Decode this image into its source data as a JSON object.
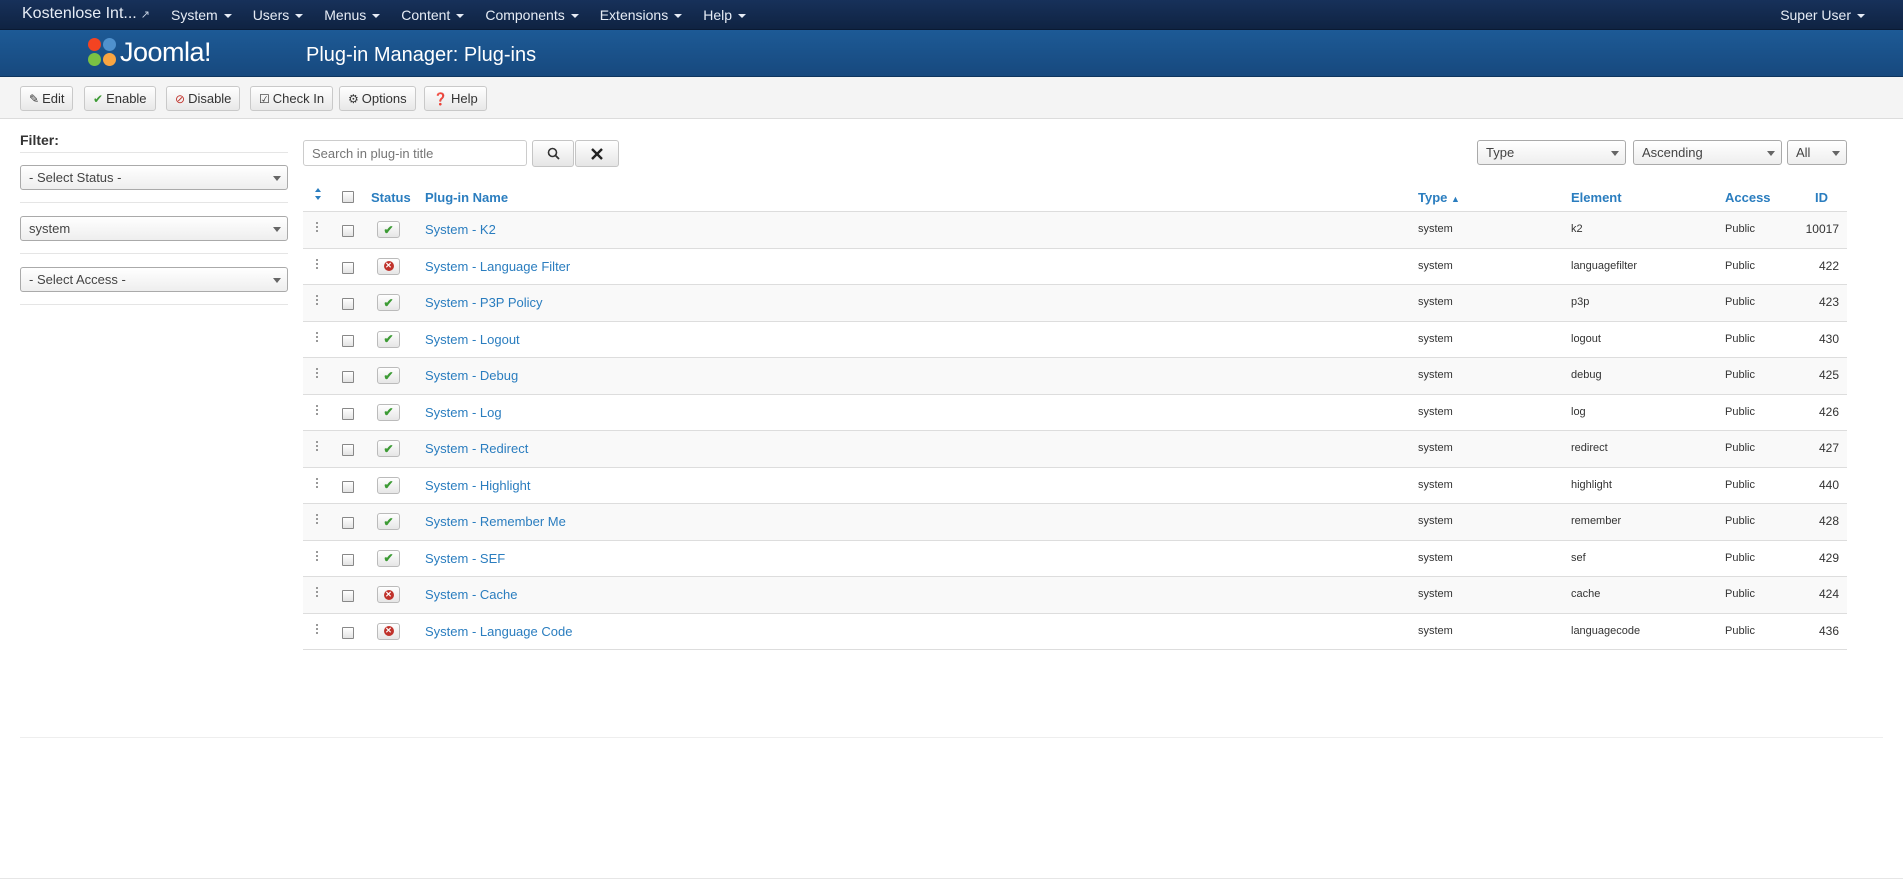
{
  "topnav": {
    "site_name": "Kostenlose Int...",
    "menus": [
      "System",
      "Users",
      "Menus",
      "Content",
      "Components",
      "Extensions",
      "Help"
    ],
    "user": "Super User"
  },
  "header": {
    "logo_text": "Joomla!",
    "title": "Plug-in Manager: Plug-ins"
  },
  "toolbar": {
    "edit": "Edit",
    "enable": "Enable",
    "disable": "Disable",
    "check_in": "Check In",
    "options": "Options",
    "help": "Help"
  },
  "sidebar": {
    "filter_label": "Filter:",
    "status_select": "- Select Status -",
    "folder_select": "system",
    "access_select": "- Select Access -"
  },
  "search": {
    "placeholder": "Search in plug-in title"
  },
  "list_controls": {
    "sort_field": "Type",
    "sort_order": "Ascending",
    "limit": "All"
  },
  "table": {
    "headers": {
      "status": "Status",
      "name": "Plug-in Name",
      "type": "Type",
      "element": "Element",
      "access": "Access",
      "id": "ID"
    },
    "rows": [
      {
        "enabled": true,
        "name": "System - K2",
        "type": "system",
        "element": "k2",
        "access": "Public",
        "id": "10017"
      },
      {
        "enabled": false,
        "name": "System - Language Filter",
        "type": "system",
        "element": "languagefilter",
        "access": "Public",
        "id": "422"
      },
      {
        "enabled": true,
        "name": "System - P3P Policy",
        "type": "system",
        "element": "p3p",
        "access": "Public",
        "id": "423"
      },
      {
        "enabled": true,
        "name": "System - Logout",
        "type": "system",
        "element": "logout",
        "access": "Public",
        "id": "430"
      },
      {
        "enabled": true,
        "name": "System - Debug",
        "type": "system",
        "element": "debug",
        "access": "Public",
        "id": "425"
      },
      {
        "enabled": true,
        "name": "System - Log",
        "type": "system",
        "element": "log",
        "access": "Public",
        "id": "426"
      },
      {
        "enabled": true,
        "name": "System - Redirect",
        "type": "system",
        "element": "redirect",
        "access": "Public",
        "id": "427"
      },
      {
        "enabled": true,
        "name": "System - Highlight",
        "type": "system",
        "element": "highlight",
        "access": "Public",
        "id": "440"
      },
      {
        "enabled": true,
        "name": "System - Remember Me",
        "type": "system",
        "element": "remember",
        "access": "Public",
        "id": "428"
      },
      {
        "enabled": true,
        "name": "System - SEF",
        "type": "system",
        "element": "sef",
        "access": "Public",
        "id": "429"
      },
      {
        "enabled": false,
        "name": "System - Cache",
        "type": "system",
        "element": "cache",
        "access": "Public",
        "id": "424"
      },
      {
        "enabled": false,
        "name": "System - Language Code",
        "type": "system",
        "element": "languagecode",
        "access": "Public",
        "id": "436"
      }
    ]
  },
  "colors": {
    "nav_bg": "#13294a",
    "header_bg": "#1d5a96",
    "link": "#2a7dbf",
    "enabled": "#3d9b35",
    "disabled": "#c0322b"
  }
}
